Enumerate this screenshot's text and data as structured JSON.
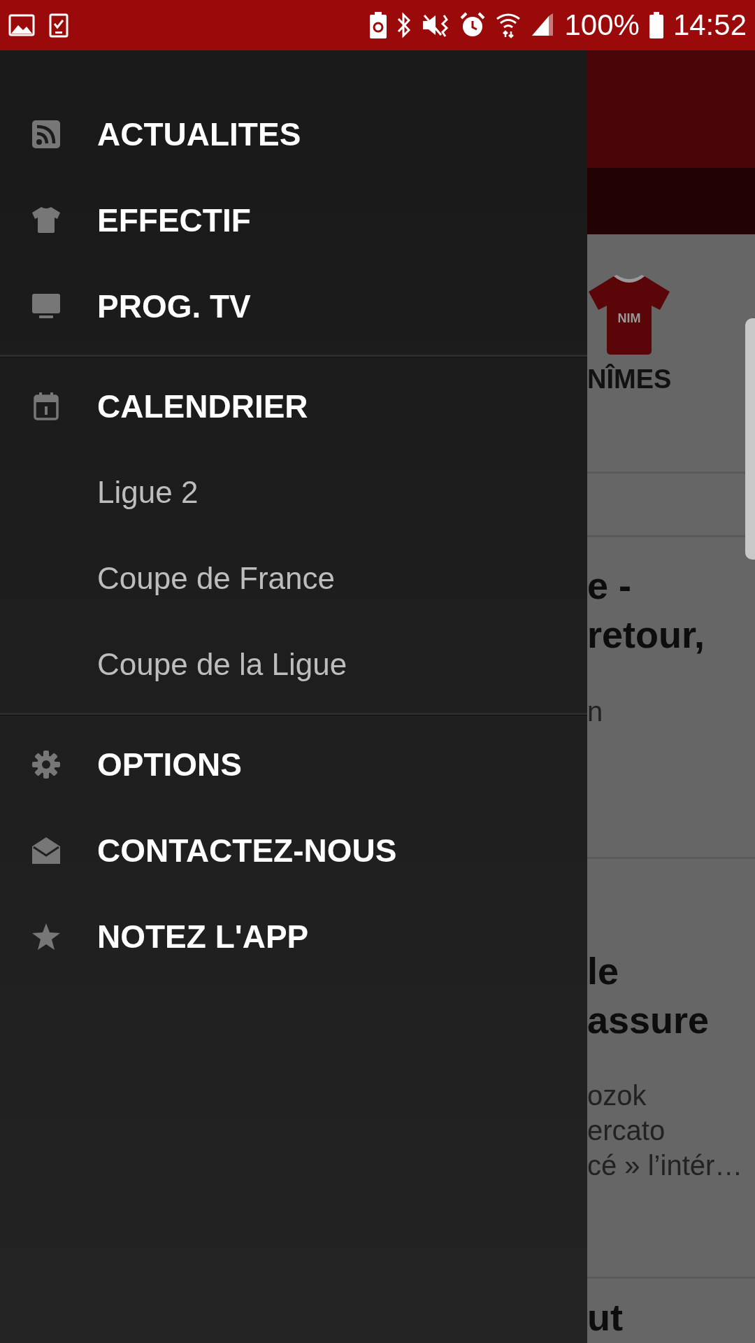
{
  "status_bar": {
    "battery": "100%",
    "time": "14:52"
  },
  "drawer": {
    "sections": [
      {
        "items": [
          {
            "label": "ACTUALITES",
            "kind": "main"
          },
          {
            "label": "EFFECTIF",
            "kind": "main"
          },
          {
            "label": "PROG. TV",
            "kind": "main"
          }
        ]
      },
      {
        "items": [
          {
            "label": "CALENDRIER",
            "kind": "main"
          },
          {
            "label": "Ligue 2",
            "kind": "sub"
          },
          {
            "label": "Coupe de France",
            "kind": "sub"
          },
          {
            "label": "Coupe de la Ligue",
            "kind": "sub"
          }
        ]
      },
      {
        "items": [
          {
            "label": "OPTIONS",
            "kind": "main"
          },
          {
            "label": "CONTACTEZ-NOUS",
            "kind": "main"
          },
          {
            "label": "NOTEZ L'APP",
            "kind": "main"
          }
        ]
      }
    ]
  },
  "background": {
    "team": {
      "jersey": "NIM",
      "name": "NÎMES"
    },
    "articles": [
      {
        "title_lines": [
          "e -",
          "retour,"
        ],
        "summary_lines": [
          "n"
        ]
      },
      {
        "title_lines": [
          "le",
          "assure"
        ],
        "summary_lines": [
          "ozok",
          "ercato",
          "cé » l’intér…"
        ]
      },
      {
        "title_lines": [
          "ut"
        ]
      }
    ]
  }
}
